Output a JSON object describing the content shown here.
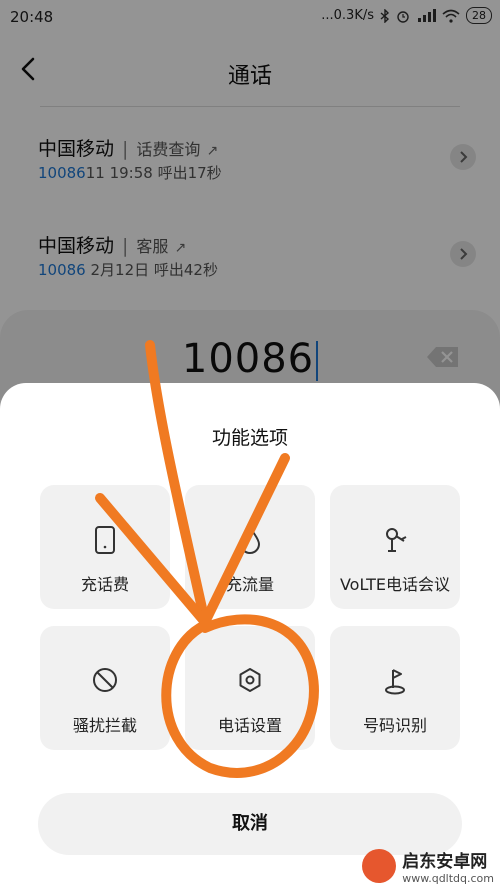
{
  "status_bar": {
    "time": "20:48",
    "network_speed": "...0.3K/s",
    "icons": [
      "bluetooth-icon",
      "alarm-icon",
      "hd-icon",
      "signal-icon",
      "wifi-icon"
    ],
    "battery": "28"
  },
  "app_bar": {
    "title": "通话"
  },
  "calls": [
    {
      "name": "中国移动",
      "tag": "话费查询",
      "number": "10086",
      "detail": "11 19:58 呼出17秒"
    },
    {
      "name": "中国移动",
      "tag": "客服",
      "number": "10086",
      "detail": " 2月12日 呼出42秒"
    }
  ],
  "dialer": {
    "number": "10086"
  },
  "sheet": {
    "title": "功能选项",
    "items": [
      {
        "label": "充话费",
        "icon": "phone-device-icon"
      },
      {
        "label": "充流量",
        "icon": "drop-icon"
      },
      {
        "label": "VoLTE电话会议",
        "icon": "conference-icon"
      },
      {
        "label": "骚扰拦截",
        "icon": "block-icon"
      },
      {
        "label": "电话设置",
        "icon": "settings-gear-icon"
      },
      {
        "label": "号码识别",
        "icon": "flag-pin-icon"
      }
    ],
    "cancel_label": "取消"
  },
  "watermark": {
    "title": "启东安卓网",
    "url": "www.qdltdq.com"
  },
  "colors": {
    "accent": "#1e78d4",
    "annotation": "#f07a22"
  }
}
